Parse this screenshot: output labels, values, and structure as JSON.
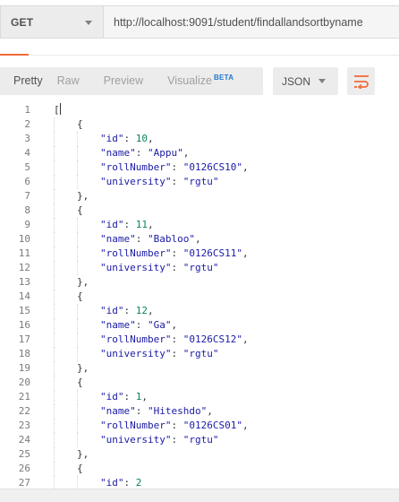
{
  "request": {
    "method": "GET",
    "url": "http://localhost:9091/student/findallandsortbyname"
  },
  "response_toolbar": {
    "tabs": [
      {
        "label": "Pretty",
        "active": true
      },
      {
        "label": "Raw",
        "active": false
      },
      {
        "label": "Preview",
        "active": false
      },
      {
        "label": "Visualize",
        "active": false,
        "badge": "BETA"
      }
    ],
    "format": "JSON",
    "wrap_icon": "wrap-lines-icon",
    "accent_color": "#f26b3a"
  },
  "body": {
    "lines": [
      {
        "n": "1",
        "indent": 0,
        "parts": [
          [
            "punc",
            "["
          ]
        ],
        "cursor": true
      },
      {
        "n": "2",
        "indent": 1,
        "parts": [
          [
            "punc",
            "{"
          ]
        ]
      },
      {
        "n": "3",
        "indent": 2,
        "parts": [
          [
            "key",
            "\"id\""
          ],
          [
            "punc",
            ": "
          ],
          [
            "num-val",
            "10"
          ],
          [
            "punc",
            ","
          ]
        ]
      },
      {
        "n": "4",
        "indent": 2,
        "parts": [
          [
            "key",
            "\"name\""
          ],
          [
            "punc",
            ": "
          ],
          [
            "str-val",
            "\"Appu\""
          ],
          [
            "punc",
            ","
          ]
        ]
      },
      {
        "n": "5",
        "indent": 2,
        "parts": [
          [
            "key",
            "\"rollNumber\""
          ],
          [
            "punc",
            ": "
          ],
          [
            "str-val",
            "\"0126CS10\""
          ],
          [
            "punc",
            ","
          ]
        ]
      },
      {
        "n": "6",
        "indent": 2,
        "parts": [
          [
            "key",
            "\"university\""
          ],
          [
            "punc",
            ": "
          ],
          [
            "str-val",
            "\"rgtu\""
          ]
        ]
      },
      {
        "n": "7",
        "indent": 1,
        "parts": [
          [
            "punc",
            "},"
          ]
        ]
      },
      {
        "n": "8",
        "indent": 1,
        "parts": [
          [
            "punc",
            "{"
          ]
        ]
      },
      {
        "n": "9",
        "indent": 2,
        "parts": [
          [
            "key",
            "\"id\""
          ],
          [
            "punc",
            ": "
          ],
          [
            "num-val",
            "11"
          ],
          [
            "punc",
            ","
          ]
        ]
      },
      {
        "n": "10",
        "indent": 2,
        "parts": [
          [
            "key",
            "\"name\""
          ],
          [
            "punc",
            ": "
          ],
          [
            "str-val",
            "\"Babloo\""
          ],
          [
            "punc",
            ","
          ]
        ]
      },
      {
        "n": "11",
        "indent": 2,
        "parts": [
          [
            "key",
            "\"rollNumber\""
          ],
          [
            "punc",
            ": "
          ],
          [
            "str-val",
            "\"0126CS11\""
          ],
          [
            "punc",
            ","
          ]
        ]
      },
      {
        "n": "12",
        "indent": 2,
        "parts": [
          [
            "key",
            "\"university\""
          ],
          [
            "punc",
            ": "
          ],
          [
            "str-val",
            "\"rgtu\""
          ]
        ]
      },
      {
        "n": "13",
        "indent": 1,
        "parts": [
          [
            "punc",
            "},"
          ]
        ]
      },
      {
        "n": "14",
        "indent": 1,
        "parts": [
          [
            "punc",
            "{"
          ]
        ]
      },
      {
        "n": "15",
        "indent": 2,
        "parts": [
          [
            "key",
            "\"id\""
          ],
          [
            "punc",
            ": "
          ],
          [
            "num-val",
            "12"
          ],
          [
            "punc",
            ","
          ]
        ]
      },
      {
        "n": "16",
        "indent": 2,
        "parts": [
          [
            "key",
            "\"name\""
          ],
          [
            "punc",
            ": "
          ],
          [
            "str-val",
            "\"Ga\""
          ],
          [
            "punc",
            ","
          ]
        ]
      },
      {
        "n": "17",
        "indent": 2,
        "parts": [
          [
            "key",
            "\"rollNumber\""
          ],
          [
            "punc",
            ": "
          ],
          [
            "str-val",
            "\"0126CS12\""
          ],
          [
            "punc",
            ","
          ]
        ]
      },
      {
        "n": "18",
        "indent": 2,
        "parts": [
          [
            "key",
            "\"university\""
          ],
          [
            "punc",
            ": "
          ],
          [
            "str-val",
            "\"rgtu\""
          ]
        ]
      },
      {
        "n": "19",
        "indent": 1,
        "parts": [
          [
            "punc",
            "},"
          ]
        ]
      },
      {
        "n": "20",
        "indent": 1,
        "parts": [
          [
            "punc",
            "{"
          ]
        ]
      },
      {
        "n": "21",
        "indent": 2,
        "parts": [
          [
            "key",
            "\"id\""
          ],
          [
            "punc",
            ": "
          ],
          [
            "num-val",
            "1"
          ],
          [
            "punc",
            ","
          ]
        ]
      },
      {
        "n": "22",
        "indent": 2,
        "parts": [
          [
            "key",
            "\"name\""
          ],
          [
            "punc",
            ": "
          ],
          [
            "str-val",
            "\"Hiteshdo\""
          ],
          [
            "punc",
            ","
          ]
        ]
      },
      {
        "n": "23",
        "indent": 2,
        "parts": [
          [
            "key",
            "\"rollNumber\""
          ],
          [
            "punc",
            ": "
          ],
          [
            "str-val",
            "\"0126CS01\""
          ],
          [
            "punc",
            ","
          ]
        ]
      },
      {
        "n": "24",
        "indent": 2,
        "parts": [
          [
            "key",
            "\"university\""
          ],
          [
            "punc",
            ": "
          ],
          [
            "str-val",
            "\"rgtu\""
          ]
        ]
      },
      {
        "n": "25",
        "indent": 1,
        "parts": [
          [
            "punc",
            "},"
          ]
        ]
      },
      {
        "n": "26",
        "indent": 1,
        "parts": [
          [
            "punc",
            "{"
          ]
        ]
      },
      {
        "n": "27",
        "indent": 2,
        "parts": [
          [
            "key",
            "\"id\""
          ],
          [
            "punc",
            ": "
          ],
          [
            "num-val",
            "2"
          ]
        ]
      }
    ]
  }
}
